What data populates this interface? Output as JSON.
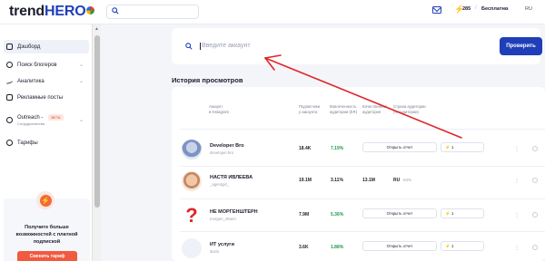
{
  "brand": {
    "logo_text": "trend",
    "logo_bold": "HERO"
  },
  "topbar": {
    "credits": "285",
    "separator": "/",
    "plan": "Бесплатно",
    "lang": "RU"
  },
  "sidebar": {
    "items": [
      {
        "label": "Дэшборд",
        "icon": "dashboard-icon",
        "active": true
      },
      {
        "label": "Поиск блогеров",
        "icon": "search-icon"
      },
      {
        "label": "Аналитика",
        "icon": "analytics-icon"
      },
      {
        "label": "Рекламные посты",
        "icon": "posts-icon"
      },
      {
        "label": "Outreach -",
        "sublabel": "Сотрудничество",
        "badge": "BETA",
        "icon": "outreach-icon"
      },
      {
        "label": "Тарифы",
        "icon": "pricing-icon"
      }
    ],
    "promo": {
      "text": "Получите больше возможностей с платной подпиской",
      "button": "Сменить тариф"
    }
  },
  "search": {
    "placeholder": "Введите аккаунт",
    "button": "Проверить"
  },
  "history": {
    "title": "История просмотров",
    "columns": [
      "Аккаунт\nв Instagram",
      "Подписчики\nу аккаунта",
      "Вовлеченность\nаудитории (ER)",
      "Качественная\nаудитория",
      "Страна аудитории\n(% аудитории)"
    ],
    "rows": [
      {
        "name": "Developer Bro",
        "handle": "developer.bro",
        "followers": "18.4K",
        "er": "7.19%",
        "quality": "",
        "country": "",
        "country_pct": "",
        "open_label": "Открыть отчет",
        "open_count": "1",
        "avatar": "dev"
      },
      {
        "name": "НАСТЯ ИВЛЕЕВА",
        "handle": "_agentgirl_",
        "followers": "19.1M",
        "er": "3.11%",
        "quality": "13.1M",
        "country": "RU",
        "country_pct": "64%",
        "open_label": "",
        "open_count": "",
        "avatar": "nastya"
      },
      {
        "name": "НЕ МОРГЕНШТЕРН",
        "handle": "morgen_shtern",
        "followers": "7.9M",
        "er": "5.36%",
        "quality": "",
        "country": "",
        "country_pct": "",
        "open_label": "Открыть отчет",
        "open_count": "1",
        "avatar": "q"
      },
      {
        "name": "ИТ услуги",
        "handle": "ituslu",
        "followers": "3.6K",
        "er": "1.88%",
        "quality": "",
        "country": "",
        "country_pct": "",
        "open_label": "Открыть отчет",
        "open_count": "1",
        "avatar": "empty"
      }
    ]
  }
}
